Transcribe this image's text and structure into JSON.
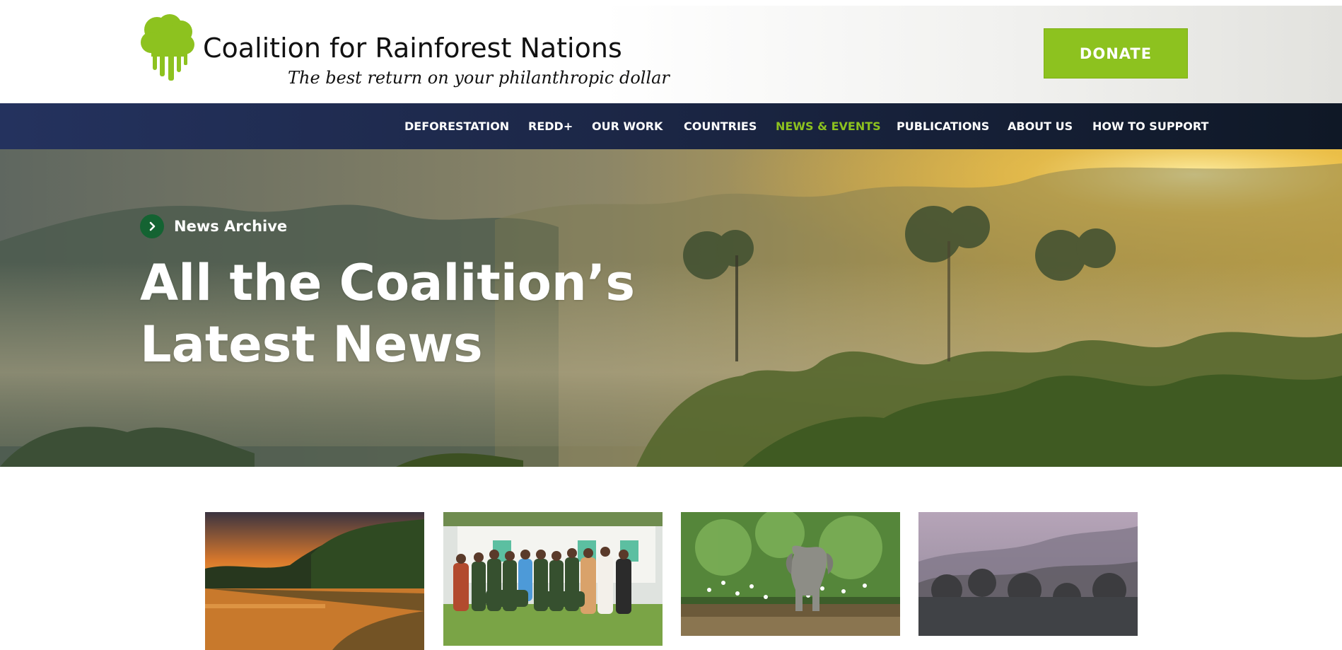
{
  "header": {
    "logo_title": "Coalition for Rainforest Nations",
    "logo_tagline": "The best return on your philanthropic dollar",
    "donate_label": "DONATE"
  },
  "nav": {
    "items": [
      {
        "label": "DEFORESTATION",
        "active": false
      },
      {
        "label": "REDD+",
        "active": false
      },
      {
        "label": "OUR WORK",
        "active": false
      },
      {
        "label": "COUNTRIES",
        "active": false
      },
      {
        "label": "NEWS & EVENTS",
        "active": true
      },
      {
        "label": "PUBLICATIONS",
        "active": false
      },
      {
        "label": "ABOUT US",
        "active": false
      },
      {
        "label": "HOW TO SUPPORT",
        "active": false
      }
    ]
  },
  "hero": {
    "crumb_label": "News Archive",
    "title_line1": "All the Coalition’s",
    "title_line2": "Latest News"
  },
  "cards": [
    {
      "image": "sunset-river-photo"
    },
    {
      "image": "group-photo"
    },
    {
      "image": "elephant-photo"
    },
    {
      "image": "misty-forest-photo"
    }
  ],
  "colors": {
    "accent_green": "#8dc21f",
    "nav_bg": "#1c2747",
    "crumb_green": "#146332"
  }
}
